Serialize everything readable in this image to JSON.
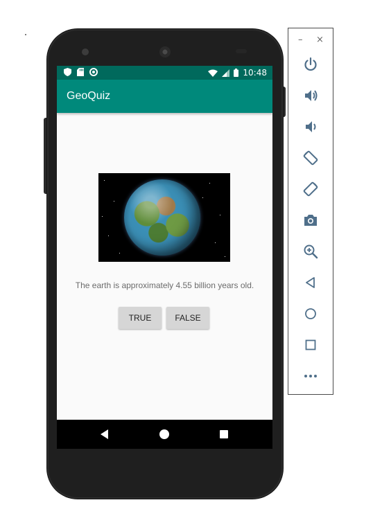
{
  "status_bar": {
    "time": "10:48",
    "left_icons": [
      "shield-icon",
      "sd-card-icon",
      "circle-notification-icon"
    ],
    "right_icons": [
      "wifi-icon",
      "cellular-signal-icon",
      "battery-icon"
    ],
    "color": "#00695c"
  },
  "app_bar": {
    "title": "GeoQuiz",
    "color": "#00897b"
  },
  "question": {
    "image_icon": "earth-image",
    "text": "The earth is approximately 4.55 billion years old."
  },
  "buttons": {
    "true_label": "TRUE",
    "false_label": "FALSE"
  },
  "nav_bar": {
    "items": [
      "back-icon",
      "home-icon",
      "recents-icon"
    ]
  },
  "emulator_panel": {
    "window_controls": {
      "minimize": "–",
      "close": "×"
    },
    "tools": [
      "power-icon",
      "volume-up-icon",
      "volume-down-icon",
      "rotate-left-icon",
      "rotate-right-icon",
      "camera-icon",
      "zoom-icon",
      "back-icon",
      "home-icon",
      "overview-icon",
      "more-icon"
    ],
    "icon_color": "#4f6f8a"
  }
}
